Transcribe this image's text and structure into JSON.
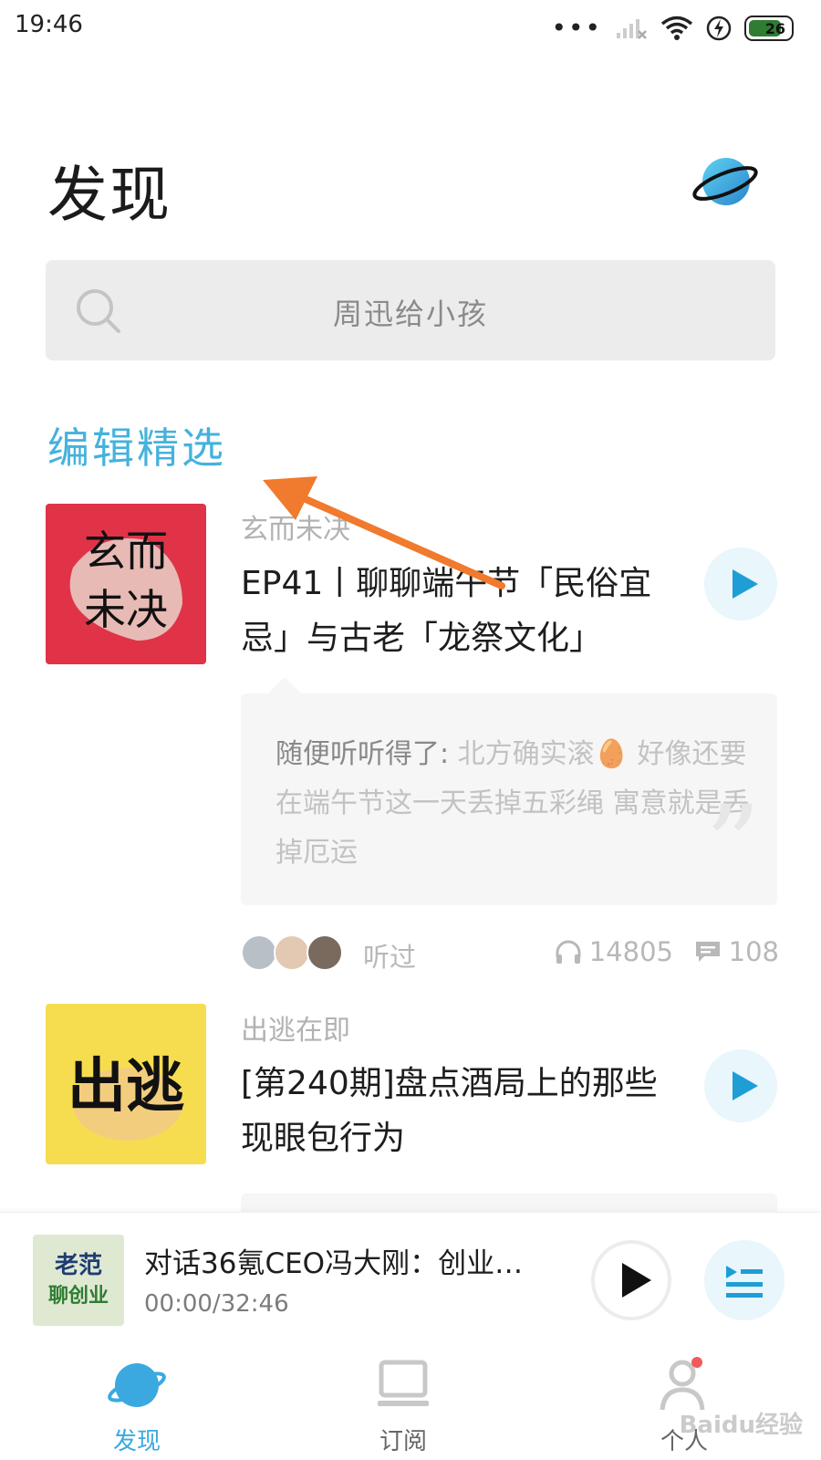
{
  "status_bar": {
    "time": "19:46",
    "battery": "26"
  },
  "header": {
    "title": "发现"
  },
  "search": {
    "placeholder": "周迅给小孩"
  },
  "section": {
    "title": "编辑精选"
  },
  "episodes": [
    {
      "cover_text": "玄而\n未决",
      "podcast": "玄而未决",
      "title": "EP41丨聊聊端午节「民俗宜忌」与古老「龙祭文化」",
      "comment_user": "随便听听得了:",
      "comment_text": " 北方确实滚🥚 好像还要在端午节这一天丢掉五彩绳 寓意就是丢掉厄运",
      "listened_label": "听过",
      "plays": "14805",
      "comments": "108"
    },
    {
      "cover_text": "出逃",
      "podcast": "出逃在即",
      "title": "[第240期]盘点酒局上的那些现眼包行为"
    }
  ],
  "player": {
    "cover_text": "老范\n聊创业",
    "title": "对话36氪CEO冯大刚：创业者...",
    "time": "00:00/32:46"
  },
  "tabs": [
    {
      "label": "发现",
      "active": true
    },
    {
      "label": "订阅",
      "active": false
    },
    {
      "label": "个人",
      "active": false
    }
  ],
  "watermark": "Baidu经验",
  "colors": {
    "accent": "#45b2dc",
    "play": "#1f9ed6",
    "cover1": "#e03348",
    "cover2": "#f6dd4f"
  }
}
